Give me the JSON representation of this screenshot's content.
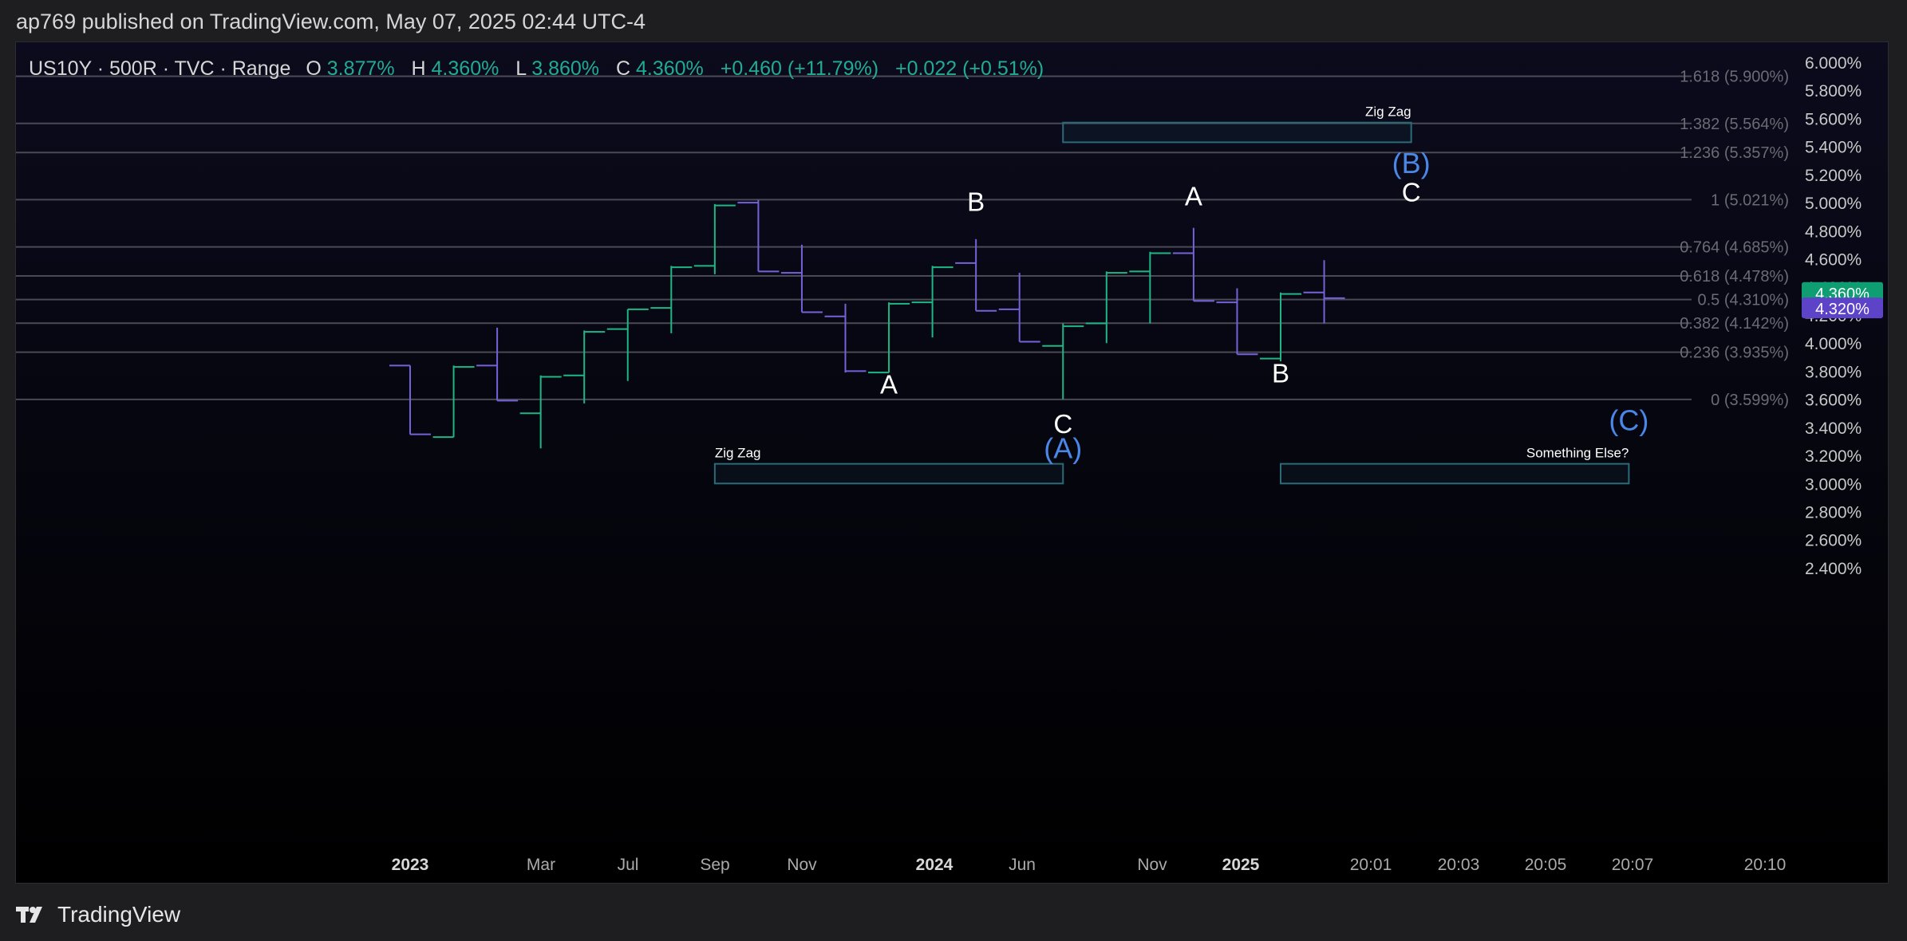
{
  "header": {
    "publisher_line": "ap769 published on TradingView.com, May 07, 2025 02:44 UTC-4"
  },
  "footer": {
    "brand": "TradingView",
    "logo_icon": "tradingview-logo-icon"
  },
  "colors": {
    "background_top": "#0b0b1d",
    "background_bottom": "#000000",
    "up_bar": "#1fb685",
    "down_bar": "#7562d8",
    "fib_line": "#4a4a55",
    "fib_label": "#6b6b74",
    "zone_border": "#2b6b78",
    "wave_label_white": "#ffffff",
    "wave_label_blue": "#4a87e6",
    "price_badge_last": "#0e9e72",
    "price_badge_prev": "#5d43c8"
  },
  "legend": {
    "symbol": "US10Y · 500R · TVC · Range",
    "open_key": "O",
    "open_val": "3.877%",
    "high_key": "H",
    "high_val": "4.360%",
    "low_key": "L",
    "low_val": "3.860%",
    "close_key": "C",
    "close_val": "4.360%",
    "change": "+0.460 (+11.79%)",
    "change2": "+0.022 (+0.51%)"
  },
  "chart_data": {
    "type": "ohlc",
    "symbol": "US10Y",
    "y_axis": {
      "ticks": [
        "2.400%",
        "2.600%",
        "2.800%",
        "3.000%",
        "3.200%",
        "3.400%",
        "3.600%",
        "3.800%",
        "4.000%",
        "4.200%",
        "4.400%",
        "4.600%",
        "4.800%",
        "5.000%",
        "5.200%",
        "5.400%",
        "5.600%",
        "5.800%",
        "6.000%"
      ],
      "range": [
        2.3,
        6.1
      ],
      "unit": "%"
    },
    "x_axis": {
      "ticks": [
        {
          "label": "2023",
          "bold": true
        },
        {
          "label": "Mar",
          "bold": false
        },
        {
          "label": "Jul",
          "bold": false
        },
        {
          "label": "Sep",
          "bold": false
        },
        {
          "label": "Nov",
          "bold": false
        },
        {
          "label": "2024",
          "bold": true
        },
        {
          "label": "Jun",
          "bold": false
        },
        {
          "label": "Nov",
          "bold": false
        },
        {
          "label": "2025",
          "bold": true
        },
        {
          "label": "20:01",
          "bold": false
        },
        {
          "label": "20:03",
          "bold": false
        },
        {
          "label": "20:05",
          "bold": false
        },
        {
          "label": "20:07",
          "bold": false
        },
        {
          "label": "20:10",
          "bold": false
        }
      ]
    },
    "bars": [
      {
        "o": 3.84,
        "h": 3.84,
        "l": 3.35,
        "c": 3.35
      },
      {
        "o": 3.33,
        "h": 3.84,
        "l": 3.33,
        "c": 3.83
      },
      {
        "o": 3.84,
        "h": 4.11,
        "l": 3.59,
        "c": 3.59
      },
      {
        "o": 3.5,
        "h": 3.77,
        "l": 3.25,
        "c": 3.76
      },
      {
        "o": 3.77,
        "h": 4.09,
        "l": 3.57,
        "c": 4.08
      },
      {
        "o": 4.1,
        "h": 4.24,
        "l": 3.73,
        "c": 4.24
      },
      {
        "o": 4.25,
        "h": 4.55,
        "l": 4.07,
        "c": 4.54
      },
      {
        "o": 4.55,
        "h": 4.99,
        "l": 4.49,
        "c": 4.98
      },
      {
        "o": 5.0,
        "h": 5.02,
        "l": 4.51,
        "c": 4.51
      },
      {
        "o": 4.5,
        "h": 4.7,
        "l": 4.22,
        "c": 4.22
      },
      {
        "o": 4.19,
        "h": 4.28,
        "l": 3.79,
        "c": 3.8
      },
      {
        "o": 3.79,
        "h": 4.29,
        "l": 3.79,
        "c": 4.28
      },
      {
        "o": 4.29,
        "h": 4.55,
        "l": 4.04,
        "c": 4.54
      },
      {
        "o": 4.57,
        "h": 4.74,
        "l": 4.23,
        "c": 4.23
      },
      {
        "o": 4.24,
        "h": 4.5,
        "l": 4.01,
        "c": 4.01
      },
      {
        "o": 3.98,
        "h": 4.14,
        "l": 3.6,
        "c": 4.12
      },
      {
        "o": 4.14,
        "h": 4.51,
        "l": 4.0,
        "c": 4.5
      },
      {
        "o": 4.51,
        "h": 4.65,
        "l": 4.14,
        "c": 4.64
      },
      {
        "o": 4.64,
        "h": 4.82,
        "l": 4.3,
        "c": 4.3
      },
      {
        "o": 4.29,
        "h": 4.39,
        "l": 3.92,
        "c": 3.92
      },
      {
        "o": 3.89,
        "h": 4.36,
        "l": 3.87,
        "c": 4.35
      },
      {
        "o": 4.36,
        "h": 4.59,
        "l": 4.14,
        "c": 4.32
      }
    ],
    "fib_levels": [
      {
        "ratio": "0 (3.599%)",
        "value": 3.599
      },
      {
        "ratio": "0.236 (3.935%)",
        "value": 3.935
      },
      {
        "ratio": "0.382 (4.142%)",
        "value": 4.142
      },
      {
        "ratio": "0.5 (4.310%)",
        "value": 4.31
      },
      {
        "ratio": "0.618 (4.478%)",
        "value": 4.478
      },
      {
        "ratio": "0.764 (4.685%)",
        "value": 4.685
      },
      {
        "ratio": "1 (5.021%)",
        "value": 5.021
      },
      {
        "ratio": "1.236 (5.357%)",
        "value": 5.357
      },
      {
        "ratio": "1.382 (5.564%)",
        "value": 5.564
      },
      {
        "ratio": "1.618 (5.900%)",
        "value": 5.9
      }
    ],
    "zones": [
      {
        "label": "Zig Zag",
        "label_pos": "top-right",
        "from_bar": 15.0,
        "to_bar": 23.0,
        "y_low": 5.43,
        "y_high": 5.57
      },
      {
        "label": "Zig Zag",
        "label_pos": "top-left",
        "from_bar": 7.0,
        "to_bar": 15.0,
        "y_low": 3.0,
        "y_high": 3.14
      },
      {
        "label": "Something Else?",
        "label_pos": "top-right",
        "from_bar": 20.0,
        "to_bar": 28.0,
        "y_low": 3.0,
        "y_high": 3.14
      }
    ],
    "wave_labels": [
      {
        "text": "A",
        "bar": 11,
        "value": 3.64,
        "color": "white"
      },
      {
        "text": "B",
        "bar": 13,
        "value": 4.94,
        "color": "white"
      },
      {
        "text": "C",
        "bar": 15,
        "value": 3.36,
        "color": "white"
      },
      {
        "text": "(A)",
        "bar": 15,
        "value": 3.18,
        "color": "blue"
      },
      {
        "text": "A",
        "bar": 18,
        "value": 4.98,
        "color": "white"
      },
      {
        "text": "B",
        "bar": 20,
        "value": 3.72,
        "color": "white"
      },
      {
        "text": "(B)",
        "bar": 23,
        "value": 5.21,
        "color": "blue"
      },
      {
        "text": "C",
        "bar": 23,
        "value": 5.01,
        "color": "white"
      },
      {
        "text": "(C)",
        "bar": 28,
        "value": 3.38,
        "color": "blue"
      }
    ],
    "price_badges": [
      {
        "text": "4.360%",
        "value": 4.36,
        "color": "last"
      },
      {
        "text": "4.320%",
        "value": 4.25,
        "color": "prev"
      }
    ]
  }
}
